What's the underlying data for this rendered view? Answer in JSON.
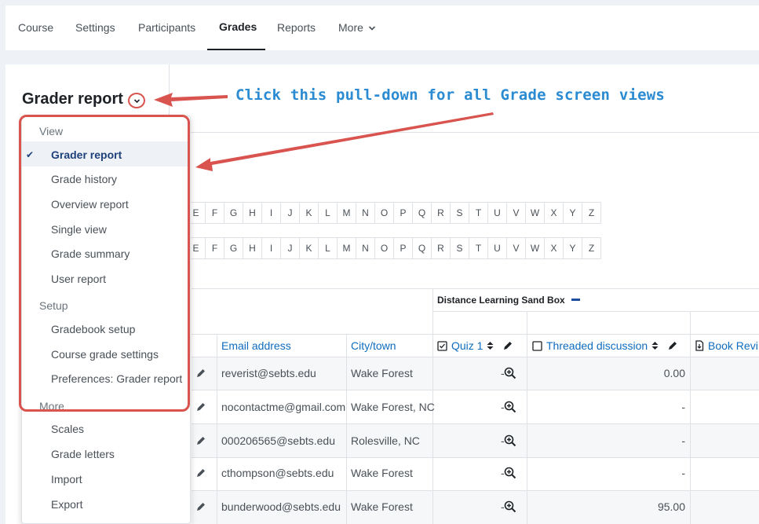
{
  "nav": {
    "tabs": [
      {
        "label": "Course"
      },
      {
        "label": "Settings"
      },
      {
        "label": "Participants"
      },
      {
        "label": "Grades"
      },
      {
        "label": "Reports"
      },
      {
        "label": "More"
      }
    ]
  },
  "page": {
    "title": "Grader report",
    "annotation": "Click this pull-down for all Grade screen views"
  },
  "menu": {
    "view_header": "View",
    "view_items": [
      "Grader report",
      "Grade history",
      "Overview report",
      "Single view",
      "Grade summary",
      "User report"
    ],
    "setup_header": "Setup",
    "setup_items": [
      "Gradebook setup",
      "Course grade settings",
      "Preferences: Grader report"
    ],
    "more_header": "More",
    "more_items": [
      "Scales",
      "Grade letters",
      "Import",
      "Export"
    ]
  },
  "letters": [
    "E",
    "F",
    "G",
    "H",
    "I",
    "J",
    "K",
    "L",
    "M",
    "N",
    "O",
    "P",
    "Q",
    "R",
    "S",
    "T",
    "U",
    "V",
    "W",
    "X",
    "Y",
    "Z"
  ],
  "table": {
    "category": "Distance Learning Sand Box",
    "headers": {
      "email": "Email address",
      "city": "City/town",
      "quiz": "Quiz 1",
      "discussion": "Threaded discussion",
      "book": "Book Revi"
    },
    "rows": [
      {
        "email": "reverist@sebts.edu",
        "city": "Wake Forest",
        "discussion": "0.00"
      },
      {
        "email": "nocontactme@gmail.com",
        "city": "Wake Forest, NC",
        "discussion": "-"
      },
      {
        "email": "000206565@sebts.edu",
        "city": "Rolesville, NC",
        "discussion": "-"
      },
      {
        "email": "cthompson@sebts.edu",
        "city": "Wake Forest",
        "discussion": "-"
      },
      {
        "email": "bunderwood@sebts.edu",
        "city": "Wake Forest",
        "discussion": "95.00"
      }
    ],
    "quiz_cell": "-"
  },
  "colors": {
    "accent": "#0f6cbf",
    "highlight": "#d9534f",
    "annotation": "#2a8bd2"
  }
}
